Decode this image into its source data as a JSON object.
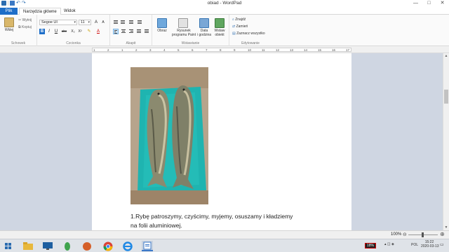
{
  "window": {
    "title": "obiad - WordPad",
    "minimize_glyph": "—",
    "maximize_glyph": "□",
    "close_glyph": "✕"
  },
  "quick_access": {
    "undo_glyph": "↶",
    "redo_glyph": "↷"
  },
  "tabs": [
    {
      "label": "Plik",
      "active": false
    },
    {
      "label": "Narzędzia główne",
      "active": true
    },
    {
      "label": "Widok",
      "active": false
    }
  ],
  "ribbon": {
    "clipboard": {
      "group_label": "Schowek",
      "paste_label": "Wklej",
      "cut_label": "Wytnij",
      "copy_label": "Kopiuj"
    },
    "font": {
      "group_label": "Czcionka",
      "font_name": "Segoe UI",
      "font_size": "11",
      "grow_glyph": "A",
      "shrink_glyph": "A",
      "bold_glyph": "B",
      "italic_glyph": "I",
      "underline_glyph": "U",
      "strike_glyph": "abc",
      "subscript_glyph": "X₂",
      "superscript_glyph": "X²",
      "color_glyph": "A"
    },
    "paragraph": {
      "group_label": "Akapit"
    },
    "insert": {
      "group_label": "Wstawianie",
      "picture_label": "Obraz",
      "paint_label_1": "Rysunek",
      "paint_label_2": "programu Paint",
      "datetime_label_1": "Data",
      "datetime_label_2": "i godzina",
      "object_label_1": "Wstaw",
      "object_label_2": "obiekt"
    },
    "editing": {
      "group_label": "Edytowanie",
      "find_label": "Znajdź",
      "replace_label": "Zamień",
      "select_all_label": "Zaznacz wszystko"
    }
  },
  "ruler_ticks": [
    "1",
    "2",
    "1",
    "2",
    "3",
    "4",
    "5",
    "6",
    "7",
    "8",
    "9",
    "10",
    "11",
    "12",
    "13",
    "14",
    "15",
    "16",
    "17"
  ],
  "document": {
    "paragraph": "1.Rybę patroszymy, czyścimy, myjemy, osuszamy i kładziemy na folii aluminiowej."
  },
  "status": {
    "zoom": "100%",
    "zoom_level_percent": 100,
    "minus": "⊖",
    "plus": "⊕"
  },
  "taskbar": {
    "battery": "18%",
    "lang": "POL",
    "time": "15:22",
    "date": "2020-03-13"
  },
  "colors": {
    "accent": "#1e6ec8",
    "page_bg": "#ffffff",
    "workspace_bg": "#cfd6e2",
    "photo_board": "#1fb4b0"
  }
}
